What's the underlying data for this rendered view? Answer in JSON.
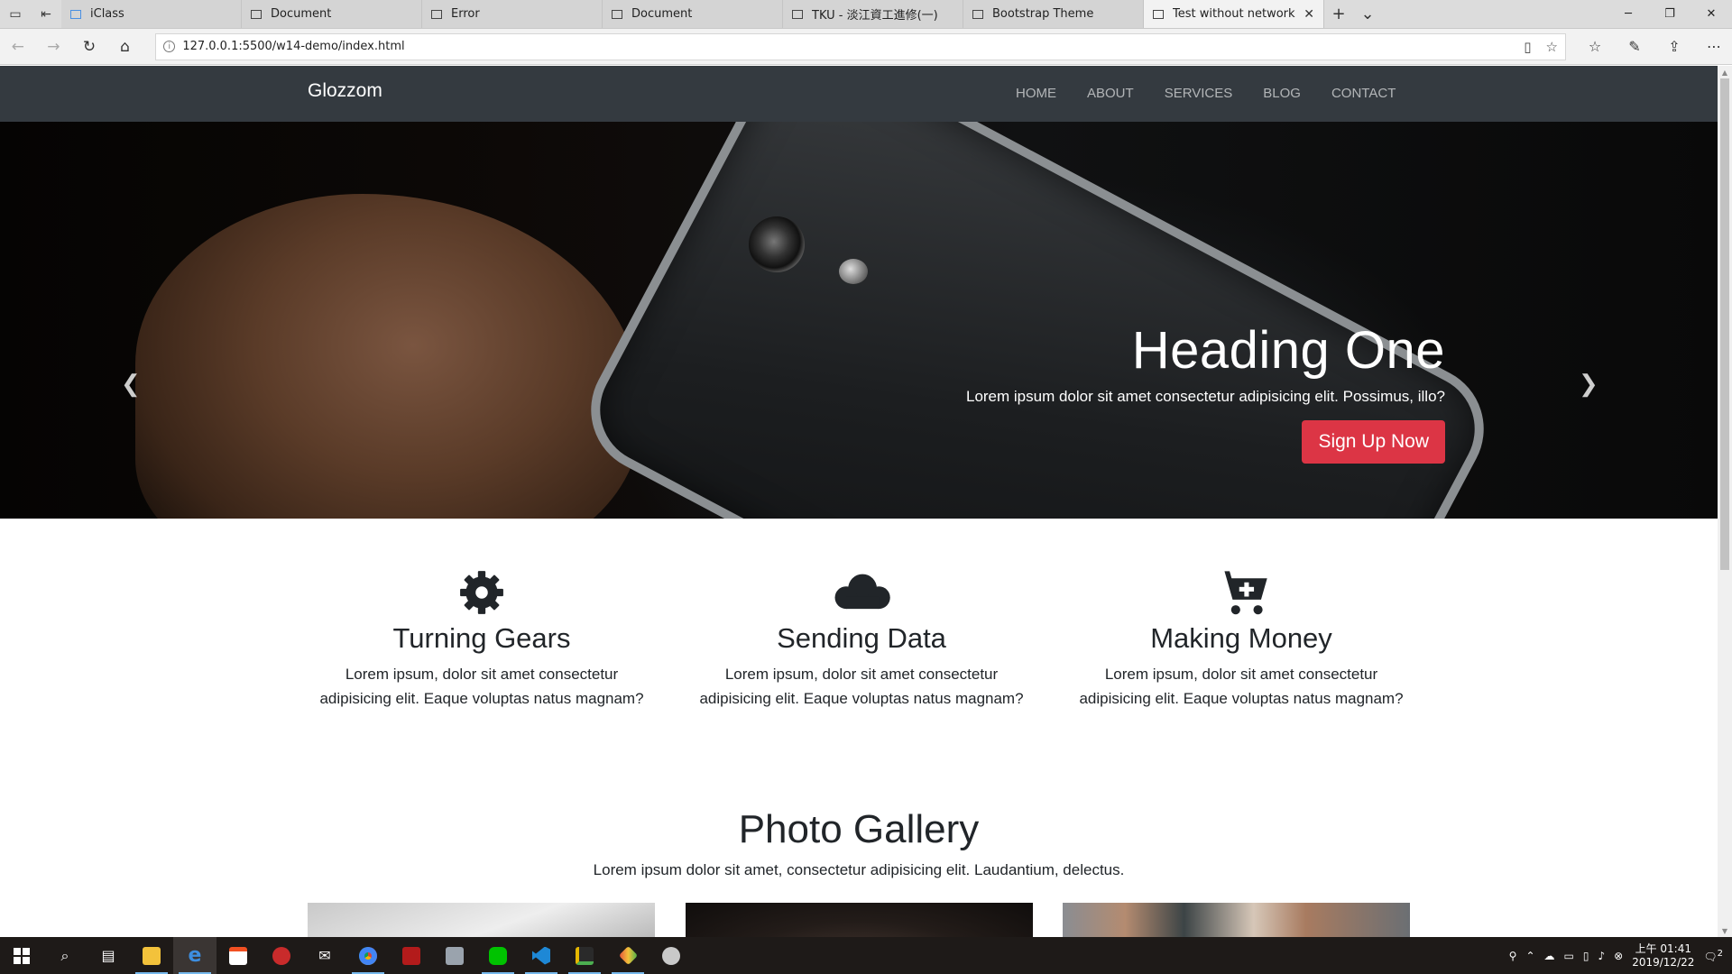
{
  "browser": {
    "tabs": [
      {
        "title": "iClass",
        "active": false
      },
      {
        "title": "Document",
        "active": false
      },
      {
        "title": "Error",
        "active": false
      },
      {
        "title": "Document",
        "active": false
      },
      {
        "title": "TKU - 淡江資工進修(一)",
        "active": false
      },
      {
        "title": "Bootstrap Theme",
        "active": false
      },
      {
        "title": "Test without network",
        "active": true
      }
    ],
    "url": "127.0.0.1:5500/w14-demo/index.html"
  },
  "site": {
    "brand": "Glozzom",
    "nav": [
      "HOME",
      "ABOUT",
      "SERVICES",
      "BLOG",
      "CONTACT"
    ]
  },
  "hero": {
    "heading": "Heading One",
    "text": "Lorem ipsum dolor sit amet consectetur adipisicing elit. Possimus, illo?",
    "button": "Sign Up Now",
    "slide_count": 3,
    "active_slide": 1
  },
  "features": [
    {
      "icon": "gear-icon",
      "title": "Turning Gears",
      "line1": "Lorem ipsum, dolor sit amet consectetur",
      "line2": "adipisicing elit. Eaque voluptas natus magnam?"
    },
    {
      "icon": "cloud-icon",
      "title": "Sending Data",
      "line1": "Lorem ipsum, dolor sit amet consectetur",
      "line2": "adipisicing elit. Eaque voluptas natus magnam?"
    },
    {
      "icon": "cart-plus-icon",
      "title": "Making Money",
      "line1": "Lorem ipsum, dolor sit amet consectetur",
      "line2": "adipisicing elit. Eaque voluptas natus magnam?"
    }
  ],
  "gallery": {
    "title": "Photo Gallery",
    "subtitle": "Lorem ipsum dolor sit amet, consectetur adipisicing elit. Laudantium, delectus."
  },
  "taskbar": {
    "clock_time": "上午 01:41",
    "clock_date": "2019/12/22",
    "notification_count": "2"
  },
  "colors": {
    "navbar": "#343a40",
    "danger": "#dc3545",
    "taskbar": "#1e1a18"
  }
}
